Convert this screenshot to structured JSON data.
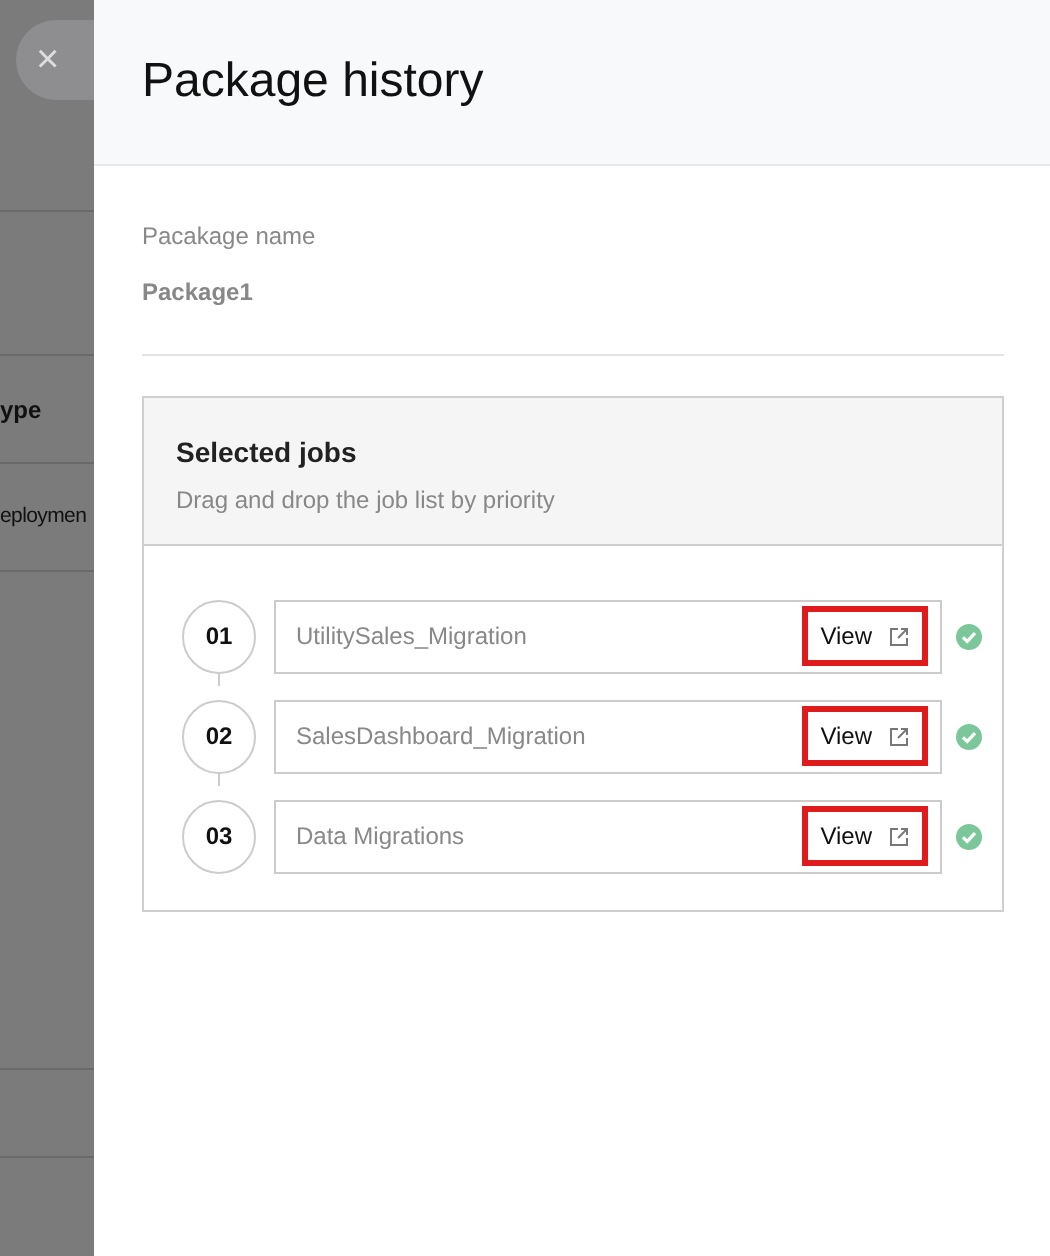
{
  "background": {
    "column_texts": [
      "ype",
      "eploymen"
    ]
  },
  "close_button": {
    "label": "×"
  },
  "panel": {
    "title": "Package history",
    "package_name": {
      "label": "Pacakage name",
      "value": "Package1"
    },
    "selected_jobs": {
      "title": "Selected jobs",
      "subtitle": "Drag and drop the job list by priority",
      "jobs": [
        {
          "number": "01",
          "name": "UtilitySales_Migration",
          "action": "View",
          "highlighted": true,
          "done": true
        },
        {
          "number": "02",
          "name": "SalesDashboard_Migration",
          "action": "View",
          "highlighted": true,
          "done": true
        },
        {
          "number": "03",
          "name": "Data Migrations",
          "action": "View",
          "highlighted": true,
          "done": true
        }
      ]
    }
  }
}
